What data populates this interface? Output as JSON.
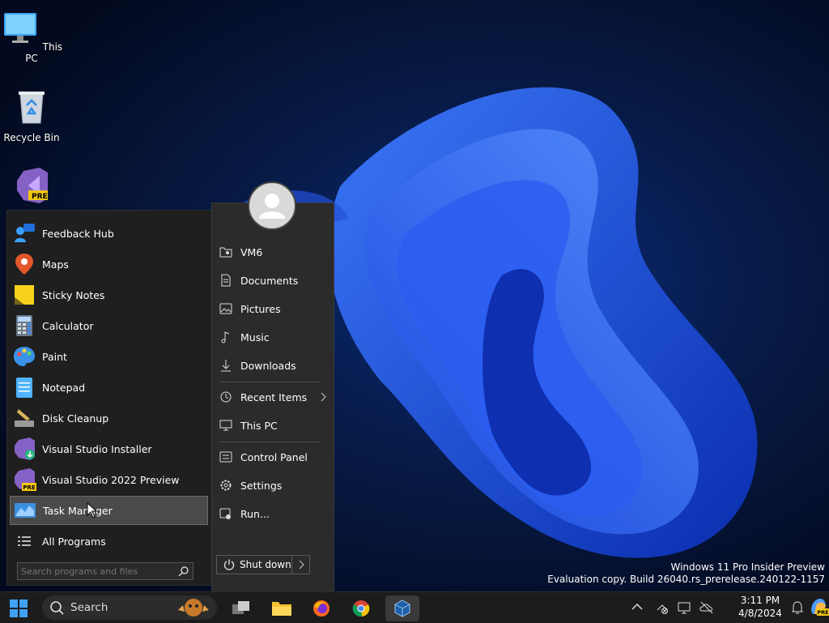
{
  "desktop": {
    "icons": [
      {
        "label": "This PC"
      },
      {
        "label": "Recycle Bin"
      },
      {
        "label": "",
        "badge": "PRE"
      }
    ]
  },
  "start_menu": {
    "programs": [
      {
        "label": "Feedback Hub",
        "icon": "feedback-hub-icon"
      },
      {
        "label": "Maps",
        "icon": "maps-icon"
      },
      {
        "label": "Sticky Notes",
        "icon": "sticky-notes-icon"
      },
      {
        "label": "Calculator",
        "icon": "calculator-icon"
      },
      {
        "label": "Paint",
        "icon": "paint-icon"
      },
      {
        "label": "Notepad",
        "icon": "notepad-icon"
      },
      {
        "label": "Disk Cleanup",
        "icon": "disk-cleanup-icon"
      },
      {
        "label": "Visual Studio Installer",
        "icon": "visual-studio-installer-icon"
      },
      {
        "label": "Visual Studio 2022 Preview",
        "icon": "visual-studio-preview-icon",
        "badge": "PRE"
      },
      {
        "label": "Task Manager",
        "icon": "task-manager-icon",
        "selected": true
      },
      {
        "label": "All Programs",
        "icon": "all-programs-icon"
      }
    ],
    "search_placeholder": "Search programs and files",
    "links": [
      {
        "label": "VM6",
        "icon": "user-folder-icon"
      },
      {
        "label": "Documents",
        "icon": "document-icon"
      },
      {
        "label": "Pictures",
        "icon": "picture-icon"
      },
      {
        "label": "Music",
        "icon": "music-note-icon"
      },
      {
        "label": "Downloads",
        "icon": "download-icon"
      },
      {
        "label": "Recent Items",
        "icon": "recent-items-icon",
        "has_submenu": true
      },
      {
        "label": "This PC",
        "icon": "computer-icon"
      },
      {
        "label": "Control Panel",
        "icon": "control-panel-icon"
      },
      {
        "label": "Settings",
        "icon": "gear-icon"
      },
      {
        "label": "Run...",
        "icon": "run-icon"
      }
    ],
    "shutdown_label": "Shut down"
  },
  "watermark": {
    "line1": "Windows 11 Pro Insider Preview",
    "line2": "Evaluation copy. Build 26040.rs_prerelease.240122-1157"
  },
  "taskbar": {
    "search_label": "Search",
    "pinned": [
      "task-view-icon",
      "file-explorer-icon",
      "firefox-icon",
      "chrome-icon",
      "virtualbox-icon"
    ],
    "clock_time": "3:11 PM",
    "clock_date": "4/8/2024",
    "tray_badge": "PRE"
  },
  "colors": {
    "accent": "#0078d4",
    "taskbar": "#1c1c1c",
    "menu_bg": "#1f1f1f"
  }
}
